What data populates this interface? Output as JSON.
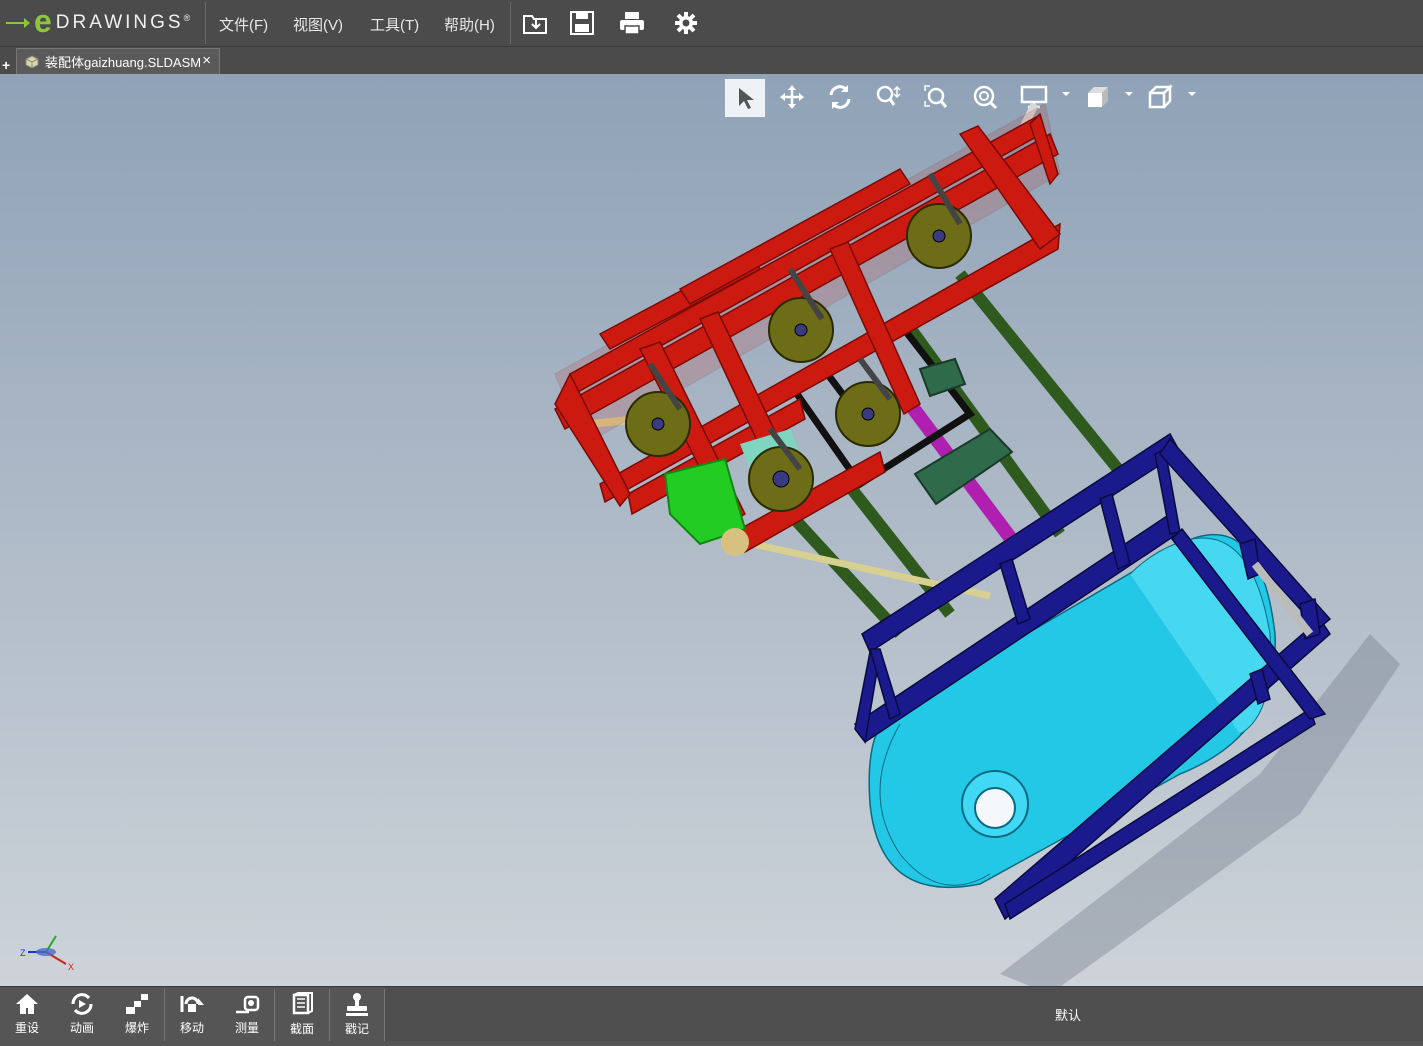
{
  "app": {
    "logo_letter": "e",
    "logo_text": "DRAWINGS",
    "logo_reg": "®"
  },
  "menu": [
    {
      "label": "文件(F)"
    },
    {
      "label": "视图(V)"
    },
    {
      "label": "工具(T)"
    },
    {
      "label": "帮助(H)"
    }
  ],
  "toolbar": {
    "icons": [
      "open-icon",
      "save-icon",
      "print-icon",
      "settings-gear-icon"
    ]
  },
  "tabs": {
    "add_symbol": "+",
    "document": {
      "label": "装配体gaizhuang.SLDASM",
      "close": "×"
    }
  },
  "view_toolbar": {
    "tools": [
      "select-arrow-icon",
      "pan-icon",
      "rotate-icon",
      "zoom-icon",
      "zoom-to-fit-icon",
      "zoom-to-area-icon",
      "display-style-icon",
      "view-orientation-icon",
      "standard-views-icon"
    ],
    "active": "select-arrow-icon"
  },
  "triad": {
    "x_label": "X",
    "y_label": "Y",
    "z_label": "Z"
  },
  "bottom_tools": [
    {
      "label": "重设",
      "icon": "home-icon"
    },
    {
      "label": "动画",
      "icon": "animate-icon"
    },
    {
      "label": "爆炸",
      "icon": "explode-icon"
    },
    {
      "label": "移动",
      "icon": "move-icon"
    },
    {
      "label": "测量",
      "icon": "measure-icon"
    },
    {
      "label": "截面",
      "icon": "section-icon"
    },
    {
      "label": "戳记",
      "icon": "stamp-icon"
    }
  ],
  "configuration": {
    "label": "默认"
  },
  "colors": {
    "frame_red": "#cc1a10",
    "frame_blue": "#1a1a8c",
    "tank_cyan": "#22c8e6",
    "pulley_olive": "#7a7a1a",
    "motor_green": "#22cc22",
    "shaft_magenta": "#b020b0",
    "rod_green": "#2e5a1e",
    "pipe_tan": "#d8d090"
  }
}
